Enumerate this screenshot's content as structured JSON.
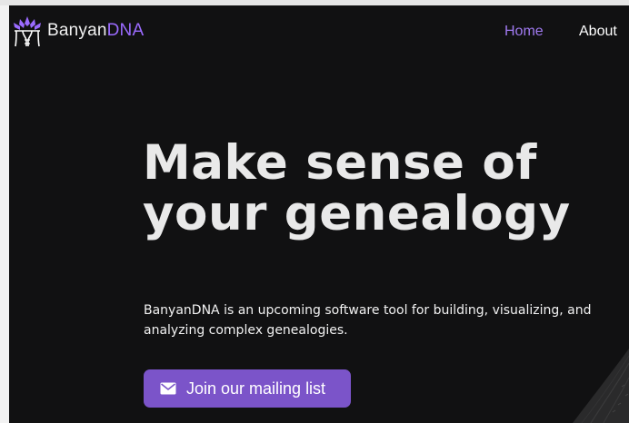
{
  "brand": {
    "name_part1": "Banyan",
    "name_part2": "DNA",
    "logo_icon": "banyan-tree-logo-icon",
    "accent_color": "#9b6bff"
  },
  "nav": {
    "items": [
      {
        "label": "Home",
        "active": true,
        "color": "#a07af0"
      },
      {
        "label": "About",
        "active": false,
        "color": "#ffffff"
      }
    ]
  },
  "hero": {
    "title_line1": "Make sense of",
    "title_line2": "your genealogy",
    "description": "BanyanDNA is an upcoming software tool for building, visualizing, and analyzing complex genealogies.",
    "cta": {
      "label": "Join our mailing list",
      "icon": "envelope-icon",
      "background_color": "#7b54c9"
    }
  },
  "colors": {
    "page_background": "#111112",
    "title_text": "#e9e9e9"
  }
}
